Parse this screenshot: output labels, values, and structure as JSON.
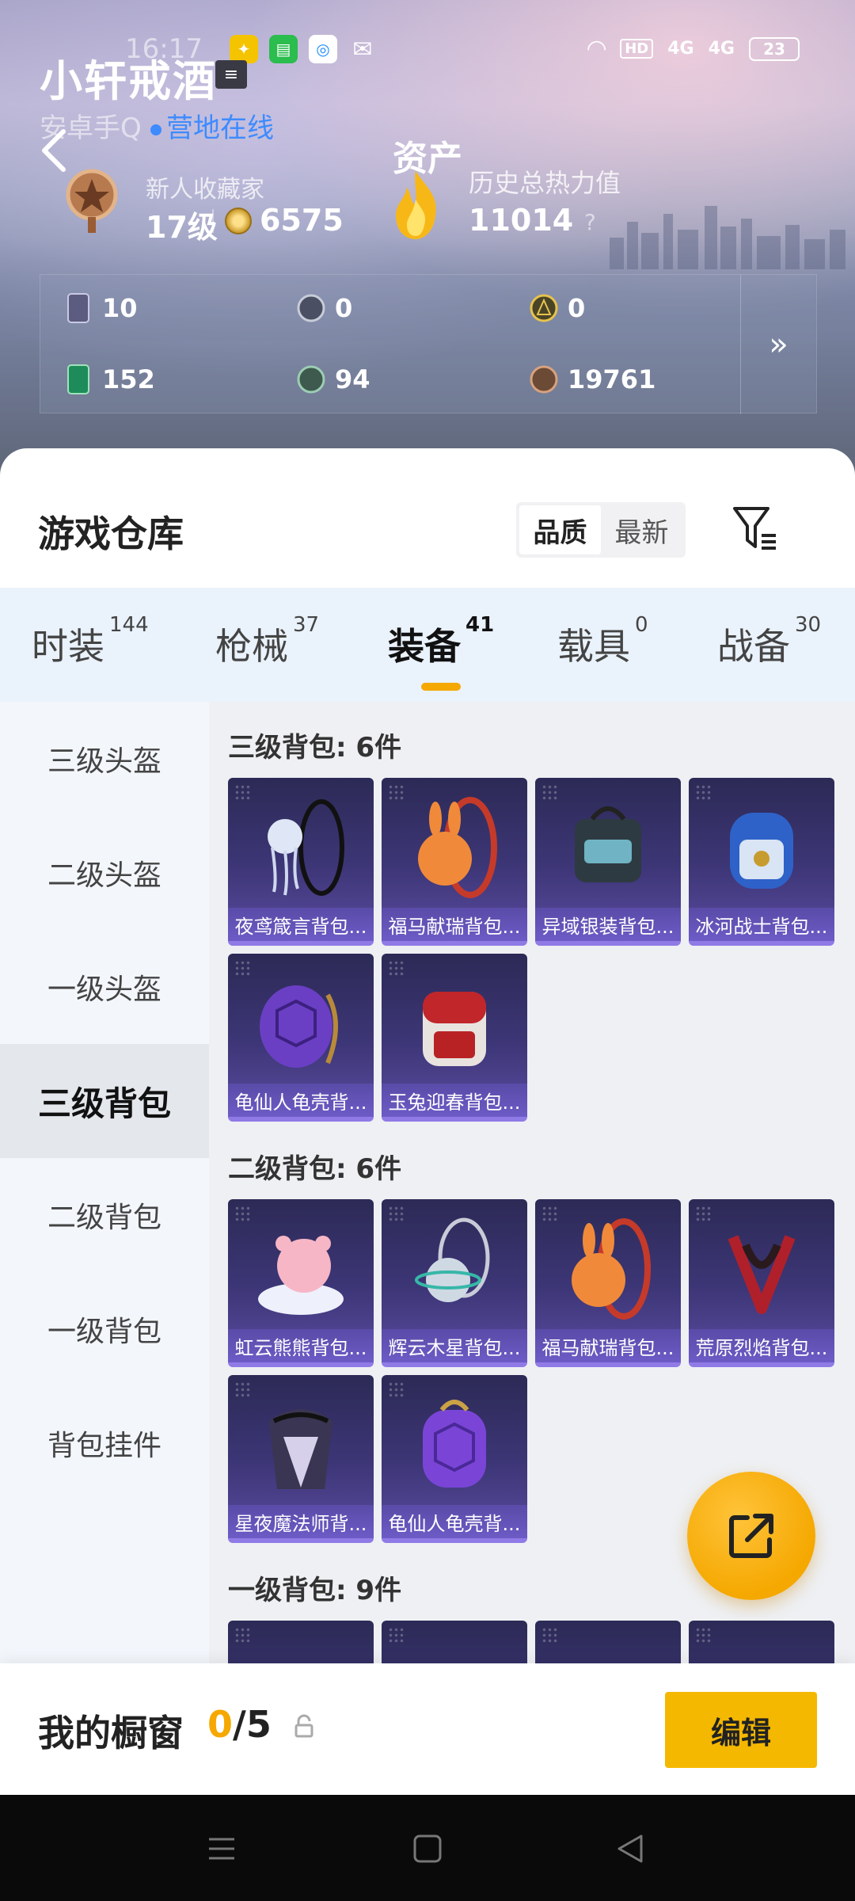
{
  "status": {
    "time": "16:17",
    "signal1": "4G",
    "signal2": "4G",
    "hd": "HD",
    "battery": "23"
  },
  "profile": {
    "username": "小轩戒酒",
    "platform": "安卓手Q",
    "online": "营地在线"
  },
  "page": {
    "title": "资产"
  },
  "rank": {
    "title": "新人收藏家",
    "level": "17级",
    "points": "6575"
  },
  "heat": {
    "title": "历史总热力值",
    "value": "11014",
    "help": "?"
  },
  "assets": {
    "items": [
      {
        "icon": "card-icon",
        "value": "10"
      },
      {
        "icon": "silver-token-icon",
        "value": "0"
      },
      {
        "icon": "gold-token-icon",
        "value": "0"
      },
      {
        "icon": "green-card-icon",
        "value": "152"
      },
      {
        "icon": "green-coin-icon",
        "value": "94"
      },
      {
        "icon": "bronze-coin-icon",
        "value": "19761"
      }
    ],
    "more": "»"
  },
  "warehouse": {
    "title": "游戏仓库",
    "sort_quality": "品质",
    "sort_latest": "最新"
  },
  "tabs": [
    {
      "label": "时装",
      "count": "144"
    },
    {
      "label": "枪械",
      "count": "37"
    },
    {
      "label": "装备",
      "count": "41"
    },
    {
      "label": "载具",
      "count": "0"
    },
    {
      "label": "战备",
      "count": "30"
    }
  ],
  "sidebar": {
    "items": [
      "三级头盔",
      "二级头盔",
      "一级头盔",
      "三级背包",
      "二级背包",
      "一级背包",
      "背包挂件"
    ]
  },
  "sections": {
    "s3": {
      "title": "三级背包: 6件",
      "items": [
        "夜鸢箴言背包...",
        "福马献瑞背包...",
        "异域银装背包...",
        "冰河战士背包...",
        "龟仙人龟壳背...",
        "玉兔迎春背包..."
      ]
    },
    "s2": {
      "title": "二级背包: 6件",
      "items": [
        "虹云熊熊背包...",
        "辉云木星背包...",
        "福马献瑞背包...",
        "荒原烈焰背包...",
        "星夜魔法师背...",
        "龟仙人龟壳背..."
      ]
    },
    "s1": {
      "title": "一级背包: 9件"
    }
  },
  "showcase": {
    "title": "我的橱窗",
    "current": "0",
    "total": "/5",
    "edit": "编辑"
  }
}
